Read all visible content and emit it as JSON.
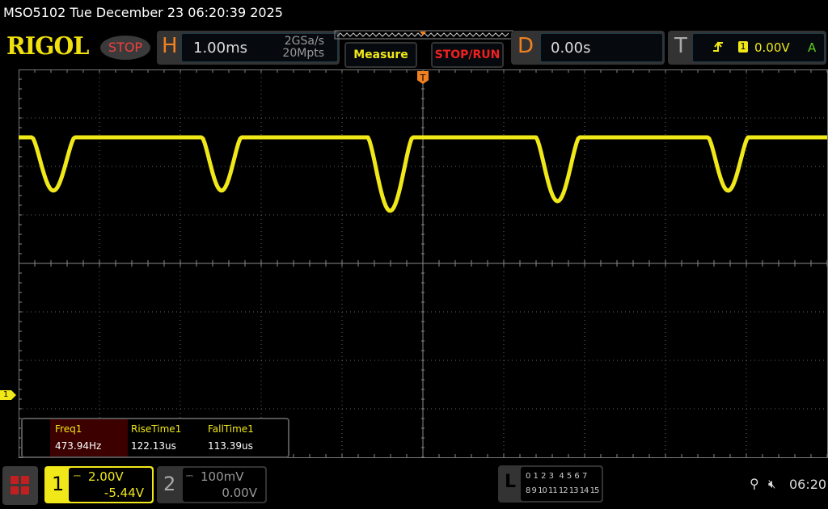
{
  "header": {
    "title": "MSO5102  Tue December 23 06:20:39 2025",
    "logo": "RIGOL",
    "status": "STOP"
  },
  "horizontal": {
    "label": "H",
    "timebase": "1.00ms",
    "sample_rate": "2GSa/s",
    "memory_depth": "20Mpts"
  },
  "buttons": {
    "measure": "Measure",
    "stop_run": "STOP/RUN"
  },
  "delay": {
    "label": "D",
    "value": "0.00s"
  },
  "trigger": {
    "label": "T",
    "edge_icon": "rising-edge-icon",
    "source": "1",
    "level": "0.00V",
    "mode": "A"
  },
  "markers": {
    "trigger_pos": "T",
    "ch1_ground": "1"
  },
  "measurements": [
    {
      "name": "Freq1",
      "value": "473.94Hz"
    },
    {
      "name": "RiseTime1",
      "value": "122.13us"
    },
    {
      "name": "FallTime1",
      "value": "113.39us"
    }
  ],
  "channels": [
    {
      "num": "1",
      "scale": "2.00V",
      "offset": "-5.44V",
      "color": "#f0e818"
    },
    {
      "num": "2",
      "scale": "100mV",
      "offset": "0.00V",
      "color": "#888888"
    }
  ],
  "logic": {
    "label": "L",
    "row1": "0 1 2 3  4 5 6 7",
    "row2": "8 9 10 11 12 13 14 15"
  },
  "status_bar": {
    "time": "06:20"
  },
  "colors": {
    "ch1": "#f0e818",
    "accent": "#f08020",
    "stop": "#f04040"
  }
}
